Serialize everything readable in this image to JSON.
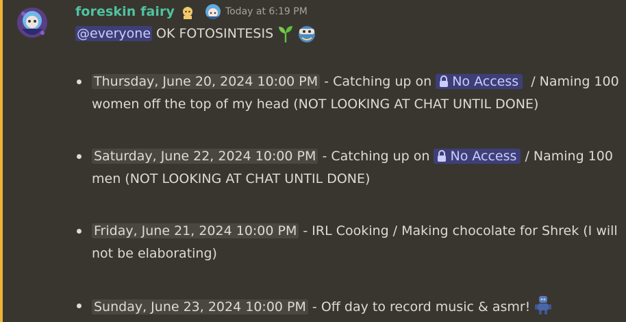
{
  "message": {
    "username": "foreskin fairy",
    "timestamp": "Today at 6:19 PM",
    "mention": "@everyone",
    "headline": "OK FOTOSINTESIS",
    "items": [
      {
        "date": "Thursday, June 20, 2024 10:00 PM",
        "pre": " - Catching up on ",
        "channel": "No Access",
        "post": "  / Naming 100 women off the top of my head (NOT LOOKING AT CHAT UNTIL DONE)"
      },
      {
        "date": "Saturday, June 22, 2024 10:00 PM",
        "pre": " - Catching up on ",
        "channel": "No Access",
        "post": " / Naming 100 men (NOT LOOKING AT CHAT UNTIL DONE)"
      },
      {
        "date": "Friday, June 21, 2024 10:00 PM",
        "text": " - IRL Cooking / Making chocolate for Shrek (I will not be elaborating)"
      },
      {
        "date": "Sunday, June 23, 2024 10:00 PM",
        "text": " - Off day to record music & asmr! "
      }
    ]
  },
  "icons": {
    "avatar": "chibi-character-avatar",
    "badge1": "green-hair-emoji-badge",
    "badge2": "chibi-emoji-badge",
    "sprout": "seedling-emoji",
    "headline_emoji": "custom-emoji",
    "lock": "lock-icon",
    "robot": "robot-emoji"
  },
  "colors": {
    "accent_bar": "#f0b232",
    "username": "#4fc3a1",
    "mention_bg": "#3e3f78",
    "mention_text": "#c9cdfb",
    "background": "#393630"
  }
}
